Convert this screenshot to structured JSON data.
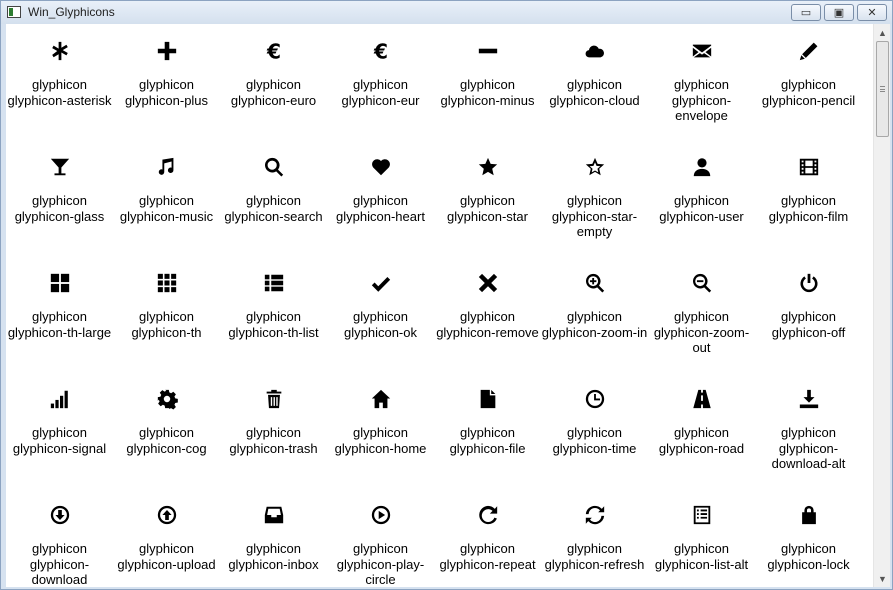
{
  "window": {
    "title": "Win_Glyphicons",
    "controls": {
      "minimize": "▭",
      "maximize": "▣",
      "close": "✕"
    }
  },
  "scrollbar": {
    "up": "▲",
    "down": "▼"
  },
  "glyphs": [
    {
      "icon": "asterisk-icon",
      "line1": "glyphicon",
      "line2": "glyphicon-asterisk"
    },
    {
      "icon": "plus-icon",
      "line1": "glyphicon",
      "line2": "glyphicon-plus"
    },
    {
      "icon": "euro-icon",
      "line1": "glyphicon",
      "line2": "glyphicon-euro"
    },
    {
      "icon": "eur-icon",
      "line1": "glyphicon",
      "line2": "glyphicon-eur"
    },
    {
      "icon": "minus-icon",
      "line1": "glyphicon",
      "line2": "glyphicon-minus"
    },
    {
      "icon": "cloud-icon",
      "line1": "glyphicon",
      "line2": "glyphicon-cloud"
    },
    {
      "icon": "envelope-icon",
      "line1": "glyphicon",
      "line2": "glyphicon-envelope"
    },
    {
      "icon": "pencil-icon",
      "line1": "glyphicon",
      "line2": "glyphicon-pencil"
    },
    {
      "icon": "glass-icon",
      "line1": "glyphicon",
      "line2": "glyphicon-glass"
    },
    {
      "icon": "music-icon",
      "line1": "glyphicon",
      "line2": "glyphicon-music"
    },
    {
      "icon": "search-icon",
      "line1": "glyphicon",
      "line2": "glyphicon-search"
    },
    {
      "icon": "heart-icon",
      "line1": "glyphicon",
      "line2": "glyphicon-heart"
    },
    {
      "icon": "star-icon",
      "line1": "glyphicon",
      "line2": "glyphicon-star"
    },
    {
      "icon": "star-empty-icon",
      "line1": "glyphicon",
      "line2": "glyphicon-star-empty"
    },
    {
      "icon": "user-icon",
      "line1": "glyphicon",
      "line2": "glyphicon-user"
    },
    {
      "icon": "film-icon",
      "line1": "glyphicon",
      "line2": "glyphicon-film"
    },
    {
      "icon": "th-large-icon",
      "line1": "glyphicon",
      "line2": "glyphicon-th-large"
    },
    {
      "icon": "th-icon",
      "line1": "glyphicon",
      "line2": "glyphicon-th"
    },
    {
      "icon": "th-list-icon",
      "line1": "glyphicon",
      "line2": "glyphicon-th-list"
    },
    {
      "icon": "ok-icon",
      "line1": "glyphicon",
      "line2": "glyphicon-ok"
    },
    {
      "icon": "remove-icon",
      "line1": "glyphicon",
      "line2": "glyphicon-remove"
    },
    {
      "icon": "zoom-in-icon",
      "line1": "glyphicon",
      "line2": "glyphicon-zoom-in"
    },
    {
      "icon": "zoom-out-icon",
      "line1": "glyphicon",
      "line2": "glyphicon-zoom-out"
    },
    {
      "icon": "off-icon",
      "line1": "glyphicon",
      "line2": "glyphicon-off"
    },
    {
      "icon": "signal-icon",
      "line1": "glyphicon",
      "line2": "glyphicon-signal"
    },
    {
      "icon": "cog-icon",
      "line1": "glyphicon",
      "line2": "glyphicon-cog"
    },
    {
      "icon": "trash-icon",
      "line1": "glyphicon",
      "line2": "glyphicon-trash"
    },
    {
      "icon": "home-icon",
      "line1": "glyphicon",
      "line2": "glyphicon-home"
    },
    {
      "icon": "file-icon",
      "line1": "glyphicon",
      "line2": "glyphicon-file"
    },
    {
      "icon": "time-icon",
      "line1": "glyphicon",
      "line2": "glyphicon-time"
    },
    {
      "icon": "road-icon",
      "line1": "glyphicon",
      "line2": "glyphicon-road"
    },
    {
      "icon": "download-alt-icon",
      "line1": "glyphicon",
      "line2": "glyphicon-download-alt"
    },
    {
      "icon": "download-icon",
      "line1": "glyphicon",
      "line2": "glyphicon-download"
    },
    {
      "icon": "upload-icon",
      "line1": "glyphicon",
      "line2": "glyphicon-upload"
    },
    {
      "icon": "inbox-icon",
      "line1": "glyphicon",
      "line2": "glyphicon-inbox"
    },
    {
      "icon": "play-circle-icon",
      "line1": "glyphicon",
      "line2": "glyphicon-play-circle"
    },
    {
      "icon": "repeat-icon",
      "line1": "glyphicon",
      "line2": "glyphicon-repeat"
    },
    {
      "icon": "refresh-icon",
      "line1": "glyphicon",
      "line2": "glyphicon-refresh"
    },
    {
      "icon": "list-alt-icon",
      "line1": "glyphicon",
      "line2": "glyphicon-list-alt"
    },
    {
      "icon": "lock-icon",
      "line1": "glyphicon",
      "line2": "glyphicon-lock"
    }
  ]
}
